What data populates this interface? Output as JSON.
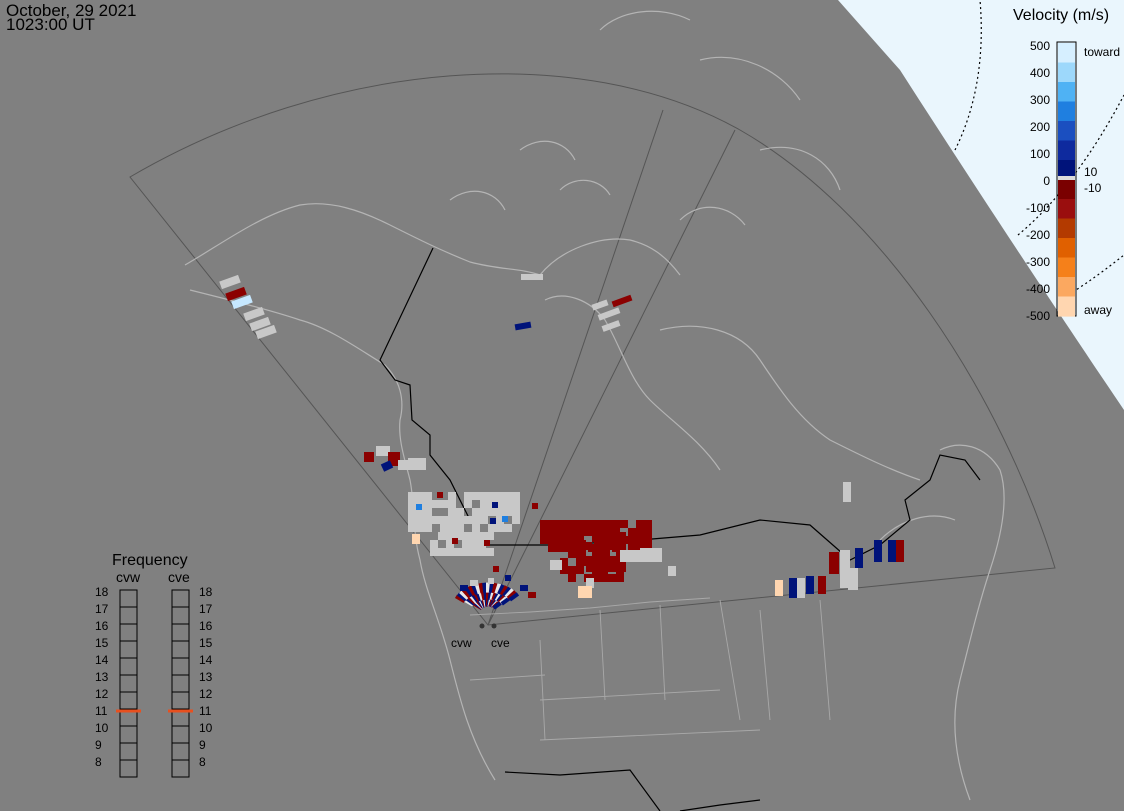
{
  "header": {
    "date": "October, 29 2021",
    "time": "1023:00 UT"
  },
  "legend": {
    "title": "Velocity (m/s)",
    "ticks": [
      "500",
      "400",
      "300",
      "200",
      "100",
      "0",
      "-100",
      "-200",
      "-300",
      "-400",
      "-500"
    ],
    "mini_labels": [
      "10",
      "-10"
    ],
    "toward_label": "toward",
    "away_label": "away"
  },
  "radars": [
    {
      "code": "cvw",
      "frequency_mhz": 11
    },
    {
      "code": "cve",
      "frequency_mhz": 11
    }
  ],
  "frequency_panel": {
    "title": "Frequency",
    "scale": [
      "18",
      "17",
      "16",
      "15",
      "14",
      "13",
      "12",
      "11",
      "10",
      "9",
      "8"
    ],
    "indicator_color": "#e8501f"
  },
  "colors": {
    "background": "#808080",
    "day_region": "#eaf6fd",
    "ground_scatter": "#c8c8c8",
    "coastline": "#b4b4b4",
    "border": "#000000",
    "fov_outline": "#555555"
  }
}
